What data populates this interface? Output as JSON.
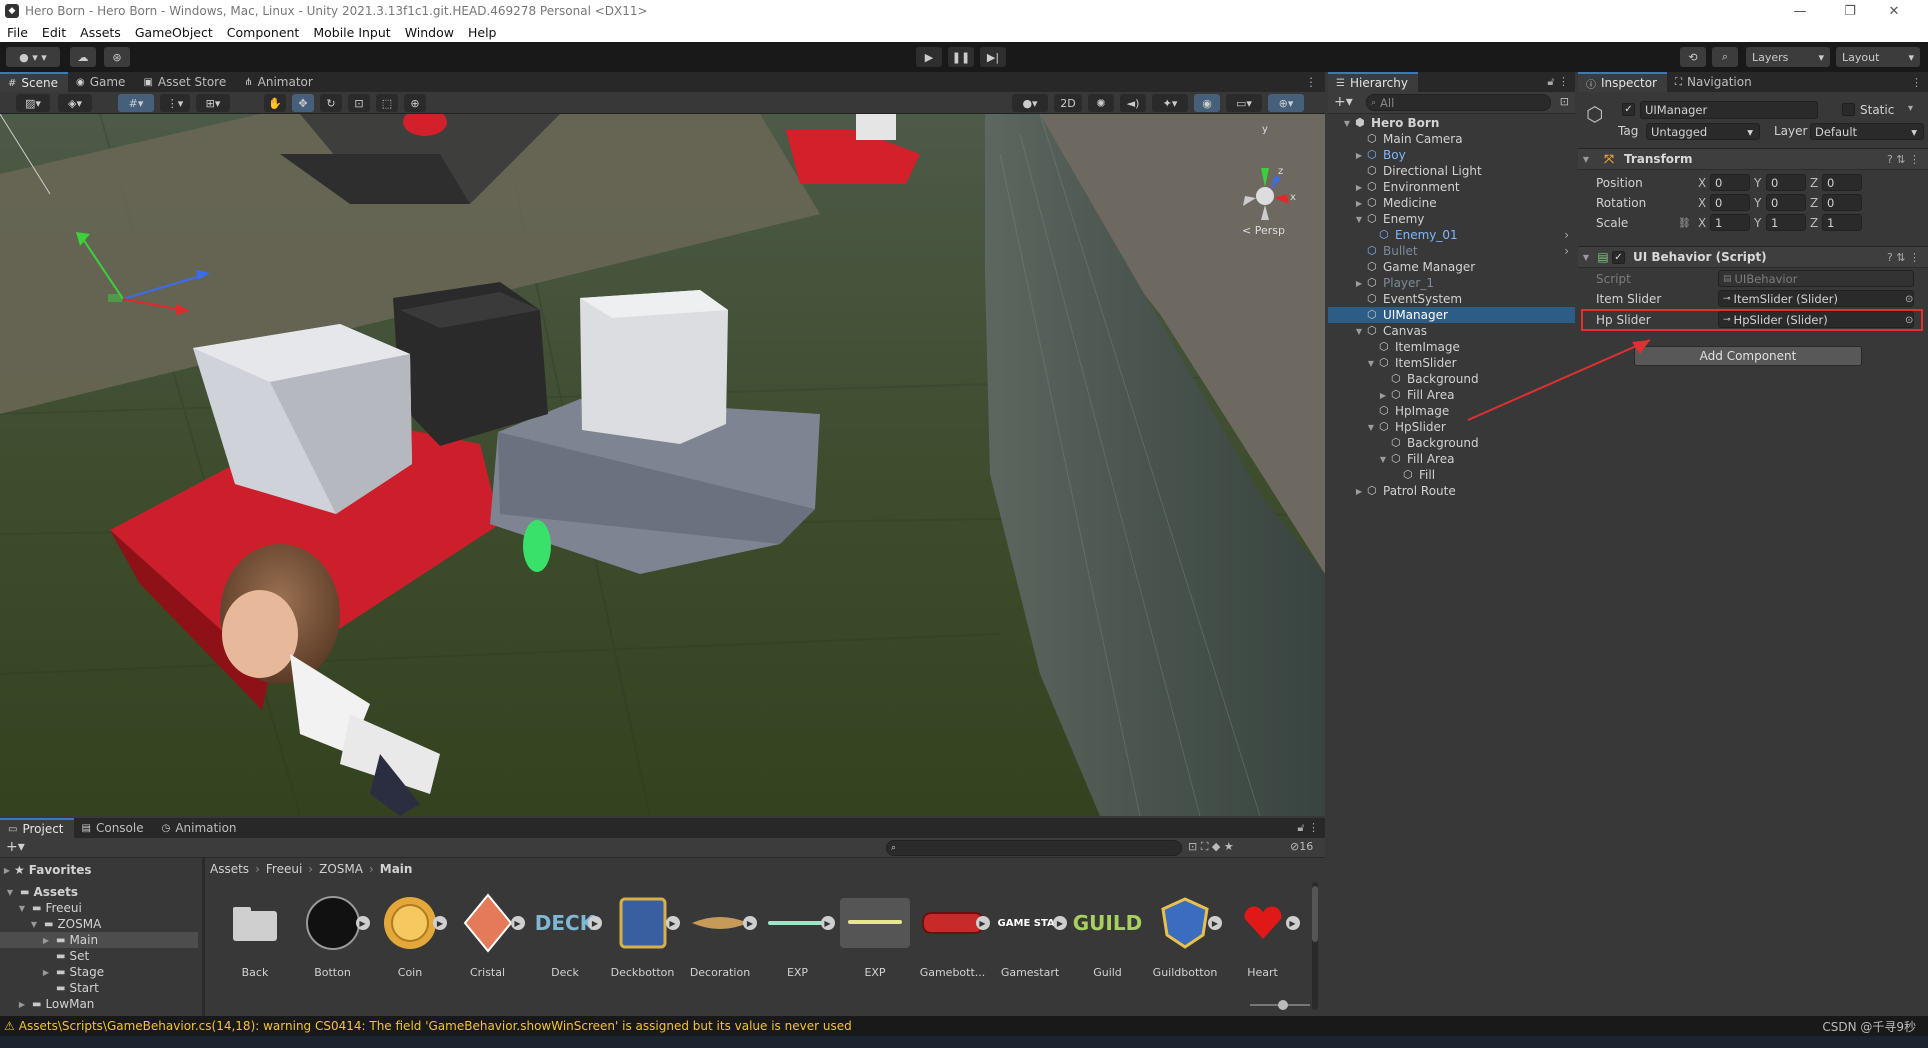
{
  "window": {
    "title": "Hero Born - Hero Born - Windows, Mac, Linux - Unity 2021.3.13f1c1.git.HEAD.469278 Personal <DX11>",
    "controls": [
      "—",
      "❐",
      "✕"
    ]
  },
  "menu": [
    "File",
    "Edit",
    "Assets",
    "GameObject",
    "Component",
    "Mobile Input",
    "Window",
    "Help"
  ],
  "toolbar": {
    "layers_label": "Layers",
    "layout_label": "Layout"
  },
  "scene_tabs": [
    {
      "label": "Scene",
      "icon": "scene-icon"
    },
    {
      "label": "Game",
      "icon": "game-icon"
    },
    {
      "label": "Asset Store",
      "icon": "store-icon"
    },
    {
      "label": "Animator",
      "icon": "animator-icon"
    }
  ],
  "scene": {
    "mode_2d": "2D",
    "persp_label": "< Persp",
    "gizmo_y": "y",
    "gizmo_x": "x",
    "gizmo_z": "z"
  },
  "hierarchy": {
    "tab": "Hierarchy",
    "search_placeholder": "All",
    "rows": [
      {
        "label": "Hero Born",
        "indent": 0,
        "arrow": "▼",
        "bold": true,
        "kind": "scene"
      },
      {
        "label": "Main Camera",
        "indent": 1,
        "arrow": "",
        "kind": "go"
      },
      {
        "label": "Boy",
        "indent": 1,
        "arrow": "▶",
        "kind": "prefab",
        "color": "blue"
      },
      {
        "label": "Directional Light",
        "indent": 1,
        "arrow": "",
        "kind": "go"
      },
      {
        "label": "Environment",
        "indent": 1,
        "arrow": "▶",
        "kind": "go"
      },
      {
        "label": "Medicine",
        "indent": 1,
        "arrow": "▶",
        "kind": "go"
      },
      {
        "label": "Enemy",
        "indent": 1,
        "arrow": "▼",
        "kind": "go"
      },
      {
        "label": "Enemy_01",
        "indent": 2,
        "arrow": "",
        "kind": "prefab",
        "color": "blue"
      },
      {
        "label": "Bullet",
        "indent": 1,
        "arrow": "",
        "kind": "prefab",
        "color": "dim"
      },
      {
        "label": "Game Manager",
        "indent": 1,
        "arrow": "",
        "kind": "go"
      },
      {
        "label": "Player_1",
        "indent": 1,
        "arrow": "▶",
        "kind": "go",
        "color": "dim"
      },
      {
        "label": "EventSystem",
        "indent": 1,
        "arrow": "",
        "kind": "go"
      },
      {
        "label": "UIManager",
        "indent": 1,
        "arrow": "",
        "kind": "go",
        "selected": true
      },
      {
        "label": "Canvas",
        "indent": 1,
        "arrow": "▼",
        "kind": "go"
      },
      {
        "label": "ItemImage",
        "indent": 2,
        "arrow": "",
        "kind": "go"
      },
      {
        "label": "ItemSlider",
        "indent": 2,
        "arrow": "▼",
        "kind": "go"
      },
      {
        "label": "Background",
        "indent": 3,
        "arrow": "",
        "kind": "go"
      },
      {
        "label": "Fill Area",
        "indent": 3,
        "arrow": "▶",
        "kind": "go"
      },
      {
        "label": "HpImage",
        "indent": 2,
        "arrow": "",
        "kind": "go"
      },
      {
        "label": "HpSlider",
        "indent": 2,
        "arrow": "▼",
        "kind": "go"
      },
      {
        "label": "Background",
        "indent": 3,
        "arrow": "",
        "kind": "go"
      },
      {
        "label": "Fill Area",
        "indent": 3,
        "arrow": "▼",
        "kind": "go"
      },
      {
        "label": "Fill",
        "indent": 4,
        "arrow": "",
        "kind": "go"
      },
      {
        "label": "Patrol Route",
        "indent": 1,
        "arrow": "▶",
        "kind": "go"
      }
    ]
  },
  "inspector": {
    "tabs": [
      "Inspector",
      "Navigation"
    ],
    "object_name": "UIManager",
    "static_label": "Static",
    "tag_label": "Tag",
    "tag_value": "Untagged",
    "layer_label": "Layer",
    "layer_value": "Default",
    "transform": {
      "title": "Transform",
      "rows": [
        {
          "label": "Position",
          "x": "0",
          "y": "0",
          "z": "0"
        },
        {
          "label": "Rotation",
          "x": "0",
          "y": "0",
          "z": "0"
        },
        {
          "label": "Scale",
          "x": "1",
          "y": "1",
          "z": "1"
        }
      ],
      "axis_x": "X",
      "axis_y": "Y",
      "axis_z": "Z"
    },
    "script_component": {
      "title": "UI Behavior (Script)",
      "script_label": "Script",
      "script_value": "UIBehavior",
      "item_slider_label": "Item Slider",
      "item_slider_value": "ItemSlider (Slider)",
      "hp_slider_label": "Hp Slider",
      "hp_slider_value": "HpSlider (Slider)"
    },
    "add_component": "Add Component"
  },
  "project": {
    "tabs": [
      {
        "label": "Project",
        "icon": "folder-icon"
      },
      {
        "label": "Console",
        "icon": "console-icon"
      },
      {
        "label": "Animation",
        "icon": "clock-icon"
      }
    ],
    "favorites": "Favorites",
    "tree": [
      {
        "label": "Assets",
        "indent": 0,
        "arrow": "▼",
        "bold": true
      },
      {
        "label": "Freeui",
        "indent": 1,
        "arrow": "▼"
      },
      {
        "label": "ZOSMA",
        "indent": 2,
        "arrow": "▼"
      },
      {
        "label": "Main",
        "indent": 3,
        "arrow": "▶",
        "selected": true
      },
      {
        "label": "Set",
        "indent": 3,
        "arrow": ""
      },
      {
        "label": "Stage",
        "indent": 3,
        "arrow": "▶"
      },
      {
        "label": "Start",
        "indent": 3,
        "arrow": ""
      },
      {
        "label": "LowMan",
        "indent": 1,
        "arrow": "▶"
      }
    ],
    "breadcrumb": [
      "Assets",
      "Freeui",
      "ZOSMA",
      "Main"
    ],
    "hidden_count": "16",
    "assets": [
      "Back",
      "Botton",
      "Coin",
      "Cristal",
      "Deck",
      "Deckbotton",
      "Decoration",
      "EXP",
      "EXP",
      "Gamebott...",
      "Gamestart",
      "Guild",
      "Guildbotton",
      "Heart"
    ],
    "deck_text": "DECK",
    "gamestart_text": "GAME STAR",
    "guild_text": "GUILD"
  },
  "status": {
    "warning": "Assets\\Scripts\\GameBehavior.cs(14,18): warning CS0414: The field 'GameBehavior.showWinScreen' is assigned but its value is never used",
    "watermark": "CSDN @千寻9秒"
  },
  "colors": {
    "accent": "#3a79bb",
    "selection": "#2c5d87",
    "highlight_box": "#e03030"
  }
}
